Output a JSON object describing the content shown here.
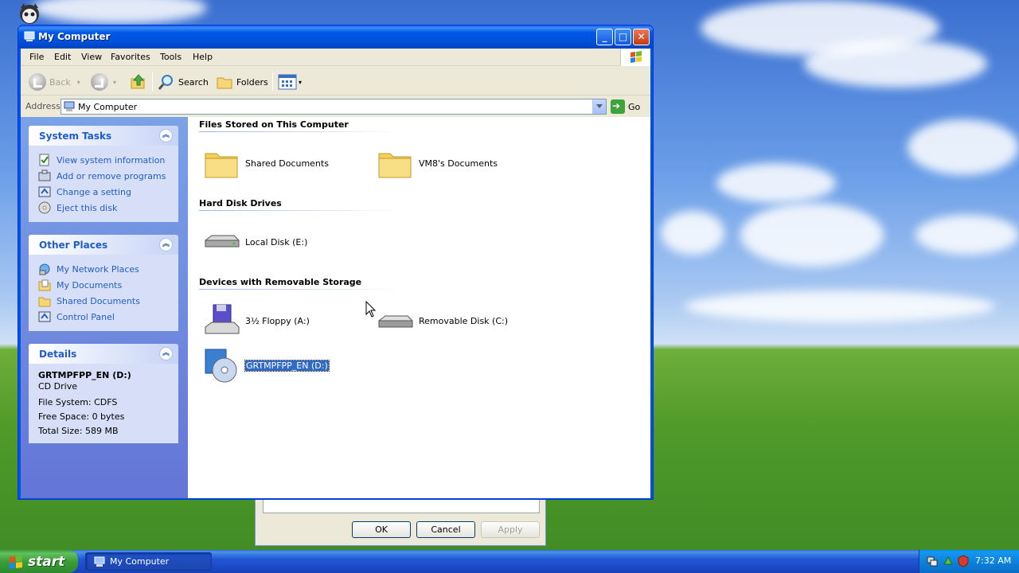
{
  "window": {
    "title": "My Computer",
    "controls": {
      "minimize": "_",
      "maximize": "□",
      "close": "✕"
    }
  },
  "menubar": [
    "File",
    "Edit",
    "View",
    "Favorites",
    "Tools",
    "Help"
  ],
  "toolbar": {
    "back": "Back",
    "search": "Search",
    "folders": "Folders"
  },
  "addressbar": {
    "label": "Address",
    "value": "My Computer",
    "go": "Go"
  },
  "taskpane": {
    "system_tasks": {
      "title": "System Tasks",
      "items": [
        "View system information",
        "Add or remove programs",
        "Change a setting",
        "Eject this disk"
      ]
    },
    "other_places": {
      "title": "Other Places",
      "items": [
        "My Network Places",
        "My Documents",
        "Shared Documents",
        "Control Panel"
      ]
    },
    "details": {
      "title": "Details",
      "name": "GRTMPFPP_EN (D:)",
      "type": "CD Drive",
      "file_system": "File System: CDFS",
      "free_space": "Free Space: 0 bytes",
      "total_size": "Total Size: 589 MB"
    }
  },
  "content": {
    "groups": [
      {
        "title": "Files Stored on This Computer",
        "items": [
          "Shared Documents",
          "VM8's Documents"
        ]
      },
      {
        "title": "Hard Disk Drives",
        "items": [
          "Local Disk (E:)"
        ]
      },
      {
        "title": "Devices with Removable Storage",
        "items": [
          "3½ Floppy (A:)",
          "Removable Disk (C:)",
          "GRTMPFPP_EN (D:)"
        ]
      }
    ],
    "selected_item": "GRTMPFPP_EN (D:)"
  },
  "background_dialog": {
    "buttons": [
      "OK",
      "Cancel",
      "Apply"
    ]
  },
  "taskbar": {
    "start": "start",
    "active_window": "My Computer",
    "clock": "7:32 AM"
  },
  "colors": {
    "titlebar": "#0054e3",
    "taskpane_link": "#215dc6",
    "selection": "#316ac5",
    "start_green": "#3b9d3a"
  }
}
